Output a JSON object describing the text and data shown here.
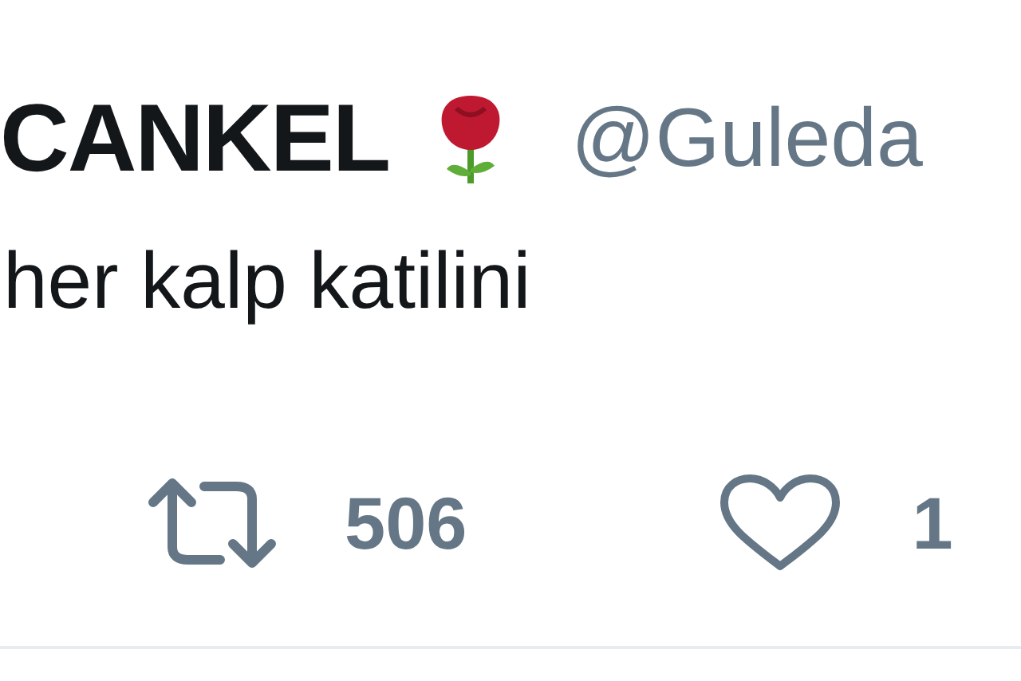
{
  "tweet": {
    "display_name": "CANKEL",
    "handle": "@Guleda",
    "text": "her kalp katilini",
    "actions": [
      {
        "kind": "retweet",
        "count": "506"
      },
      {
        "kind": "like",
        "count": "1"
      }
    ]
  }
}
